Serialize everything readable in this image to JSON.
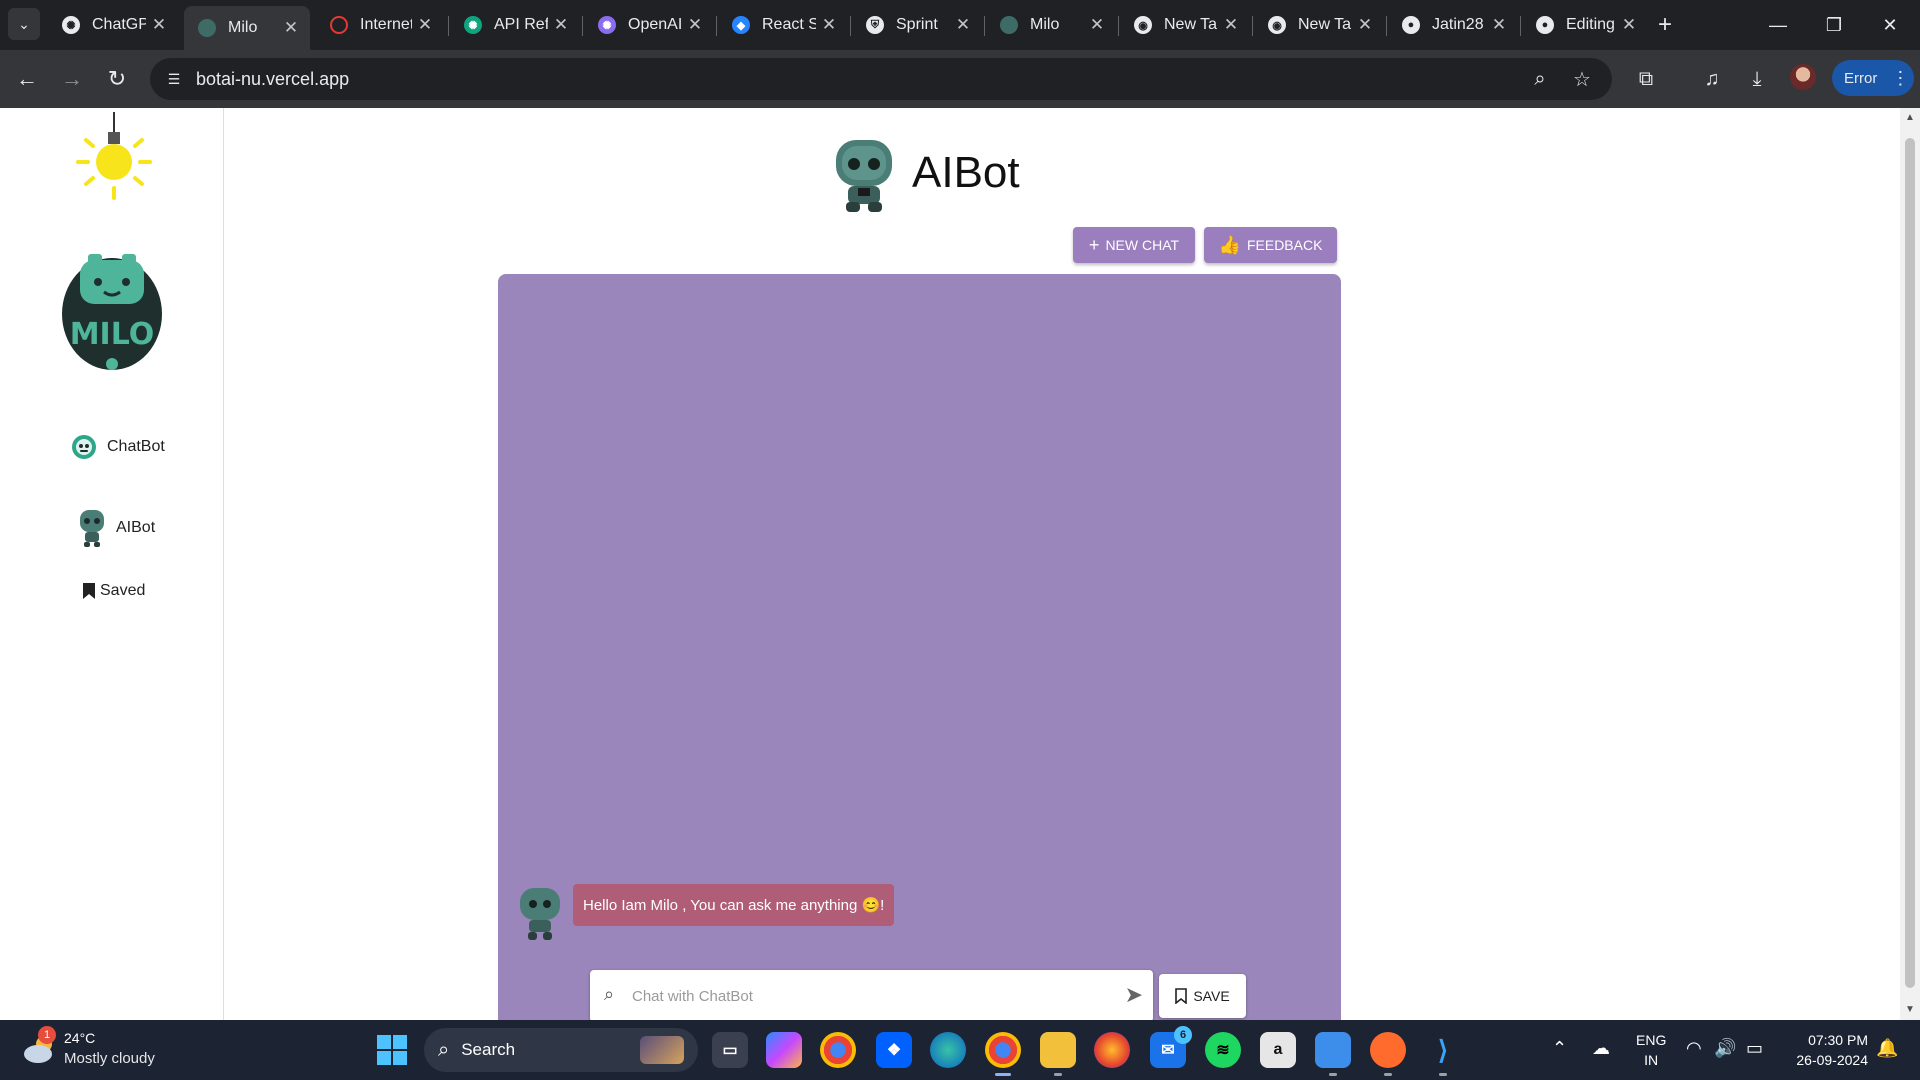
{
  "browser": {
    "tabs": [
      {
        "title": "ChatGPT",
        "icon": "openai-icon",
        "active": false
      },
      {
        "title": "Milo",
        "icon": "robot-icon",
        "active": true
      },
      {
        "title": "Internet",
        "icon": "speedometer-icon",
        "active": false
      },
      {
        "title": "API Reference",
        "icon": "openai-icon",
        "active": false
      },
      {
        "title": "OpenAI",
        "icon": "openai-icon",
        "active": false
      },
      {
        "title": "React Sprint",
        "icon": "jira-icon",
        "active": false
      },
      {
        "title": "Sprint",
        "icon": "shield-icon",
        "active": false
      },
      {
        "title": "Milo",
        "icon": "robot-icon",
        "active": false
      },
      {
        "title": "New Tab",
        "icon": "chrome-icon",
        "active": false
      },
      {
        "title": "New Tab",
        "icon": "chrome-icon",
        "active": false
      },
      {
        "title": "Jatin28",
        "icon": "github-icon",
        "active": false
      },
      {
        "title": "Editing",
        "icon": "github-icon",
        "active": false
      }
    ],
    "url": "botai-nu.vercel.app",
    "error_label": "Error"
  },
  "sidebar": {
    "items": [
      {
        "label": "ChatBot",
        "icon": "chatbot-face-icon"
      },
      {
        "label": "AIBot",
        "icon": "robot-avatar-icon"
      },
      {
        "label": "Saved",
        "icon": "bookmark-icon"
      }
    ]
  },
  "main": {
    "title": "AIBot",
    "new_chat_label": "NEW CHAT",
    "feedback_label": "FEEDBACK",
    "messages": [
      {
        "sender": "bot",
        "text": "Hello Iam Milo , You can ask me anything 😊!"
      }
    ],
    "input_placeholder": "Chat with ChatBot",
    "save_label": "SAVE"
  },
  "colors": {
    "panel": "#9a86bb",
    "button": "#9b7ebd",
    "bubble": "#b05e78",
    "accent_dark": "#1a57a8"
  },
  "taskbar": {
    "weather_badge": "1",
    "temperature": "24°C",
    "weather": "Mostly cloudy",
    "search_label": "Search",
    "mail_badge": "6",
    "lang_primary": "ENG",
    "lang_secondary": "IN",
    "time": "07:30 PM",
    "date": "26-09-2024"
  }
}
